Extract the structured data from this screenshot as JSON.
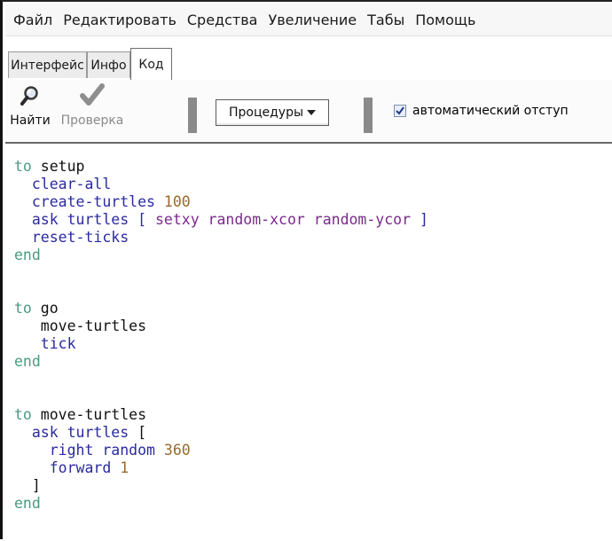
{
  "menu": [
    "Файл",
    "Редактировать",
    "Средства",
    "Увеличение",
    "Табы",
    "Помощь"
  ],
  "tabs": [
    "Интерфейс",
    "Инфо",
    "Код"
  ],
  "active_tab": "Код",
  "toolbar": {
    "find_label": "Найти",
    "check_label": "Проверка",
    "procedures_label": "Процедуры",
    "auto_indent_label": "автоматический отступ",
    "auto_indent_checked": true
  },
  "code": {
    "l1a": "to",
    "l1b": " setup",
    "l2": "  clear-all",
    "l3a": "  create-turtles ",
    "l3b": "100",
    "l4a": "  ask turtles [ ",
    "l4b": "setxy random-xcor random-ycor",
    "l4c": " ]",
    "l5": "  reset-ticks",
    "l6": "end",
    "l8a": "to",
    "l8b": " go",
    "l9": "   move-turtles",
    "l10": "   tick",
    "l11": "end",
    "l13a": "to",
    "l13b": " move-turtles",
    "l14a": "  ask turtles",
    "l14b": " [",
    "l15a": "    right random ",
    "l15b": "360",
    "l16a": "    forward ",
    "l16b": "1",
    "l17": "  ]",
    "l18": "end"
  },
  "colors": {
    "keyword_to": "#4a9a7e",
    "primitive": "#2a2aa0",
    "reporter": "#7a2a8a",
    "number": "#9a6a2a"
  },
  "icons": {
    "find": "magnifier-icon",
    "check": "checkmark-icon",
    "dropdown": "triangle-down-icon",
    "checkbox": "checkbox-checked-icon"
  }
}
